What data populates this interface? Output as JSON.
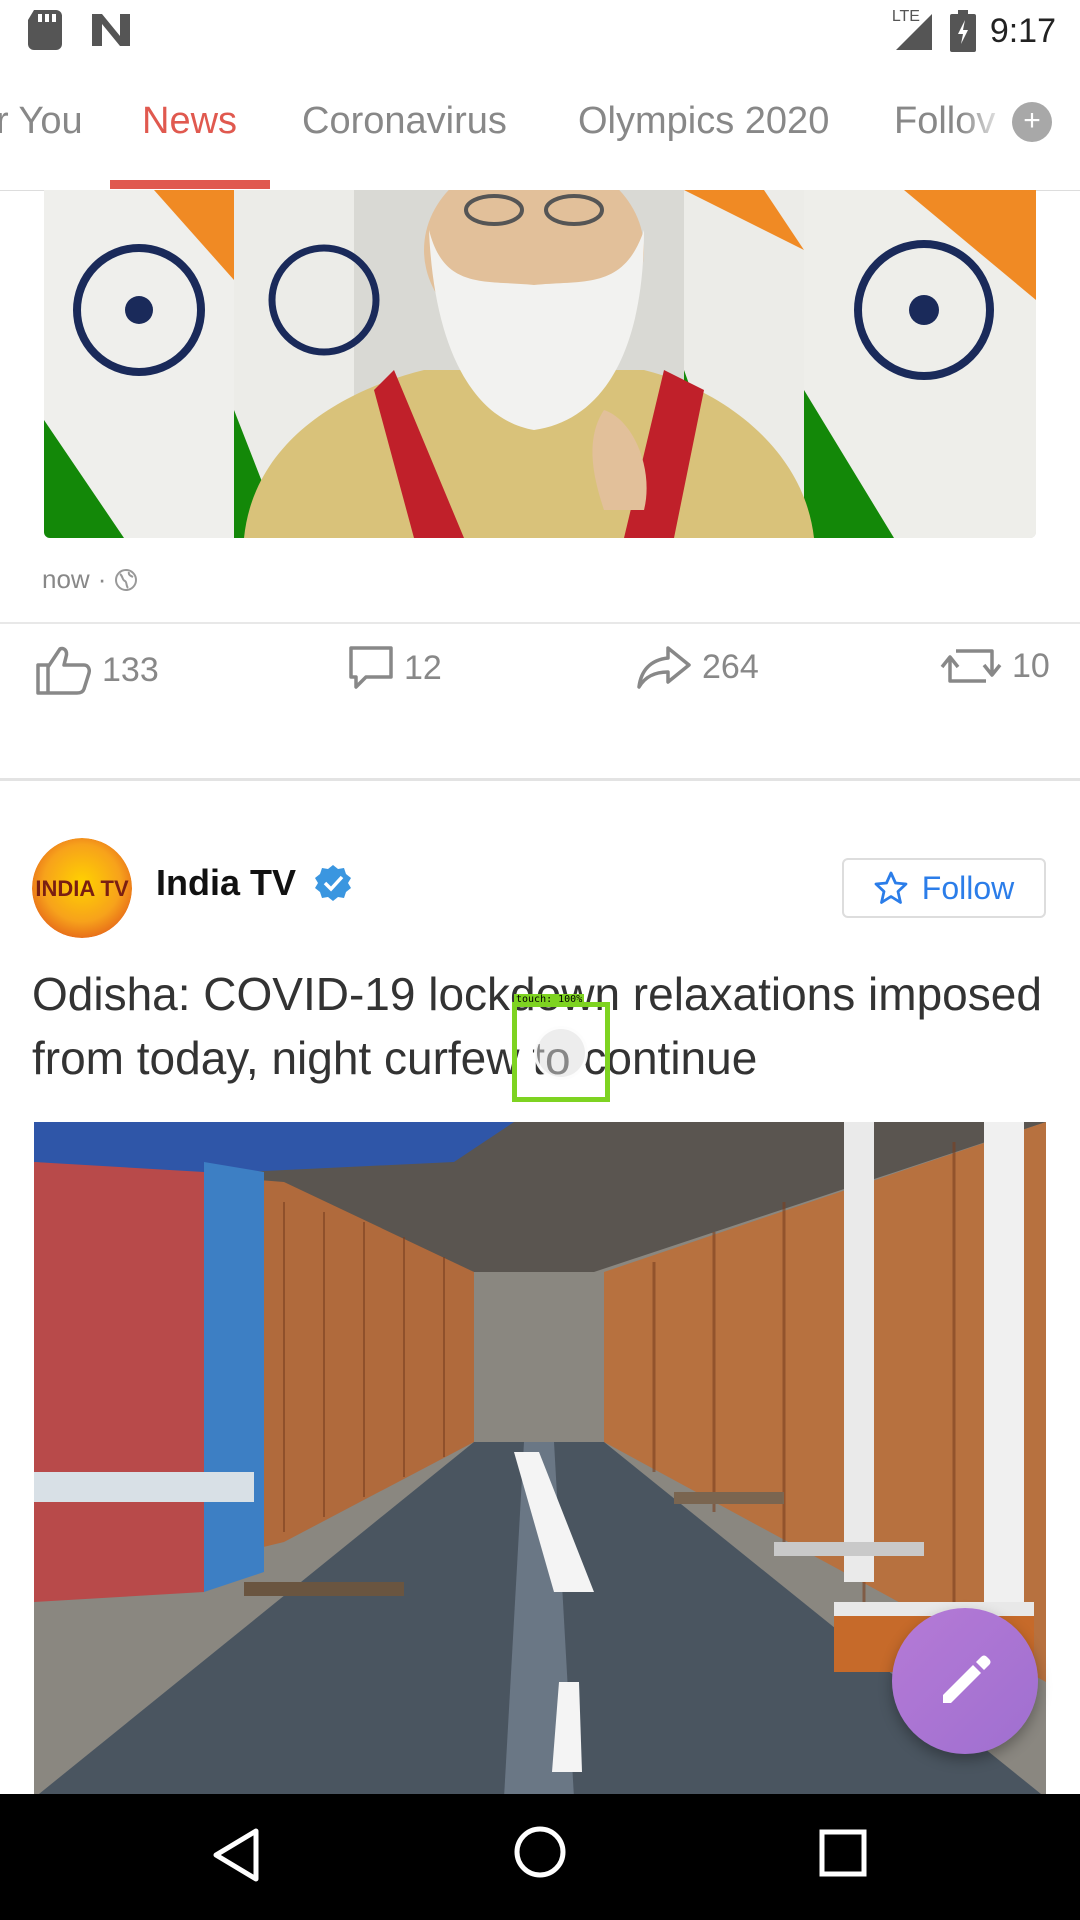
{
  "status_bar": {
    "time": "9:17",
    "network": "LTE",
    "icons": [
      "sd-card-icon",
      "n-logo-icon",
      "lte-signal-icon",
      "battery-charging-icon"
    ]
  },
  "tabs": [
    {
      "label": "For You",
      "visible_text": "r You",
      "active": false
    },
    {
      "label": "News",
      "active": true
    },
    {
      "label": "Coronavirus",
      "active": false
    },
    {
      "label": "Olympics 2020",
      "active": false
    },
    {
      "label": "Follow",
      "visible_text": "Follov",
      "active": false
    }
  ],
  "colors": {
    "accent": "#e0594f",
    "link": "#2b7de9",
    "fab": "#a974d4",
    "touch_marker": "#7ed321"
  },
  "post1": {
    "time": "now",
    "separator": "·",
    "privacy_icon": "globe-icon",
    "likes": "133",
    "comments": "12",
    "shares": "264",
    "reposts": "10"
  },
  "post2": {
    "source": "India TV",
    "avatar_text": "INDIA TV",
    "verified": true,
    "follow_label": "Follow",
    "headline": "Odisha: COVID-19 lockdown relaxations imposed from today, night curfew to continue"
  },
  "overlay": {
    "touch_label": "touch: 100%"
  },
  "navbar": {
    "buttons": [
      "back-icon",
      "home-icon",
      "recents-icon"
    ]
  }
}
